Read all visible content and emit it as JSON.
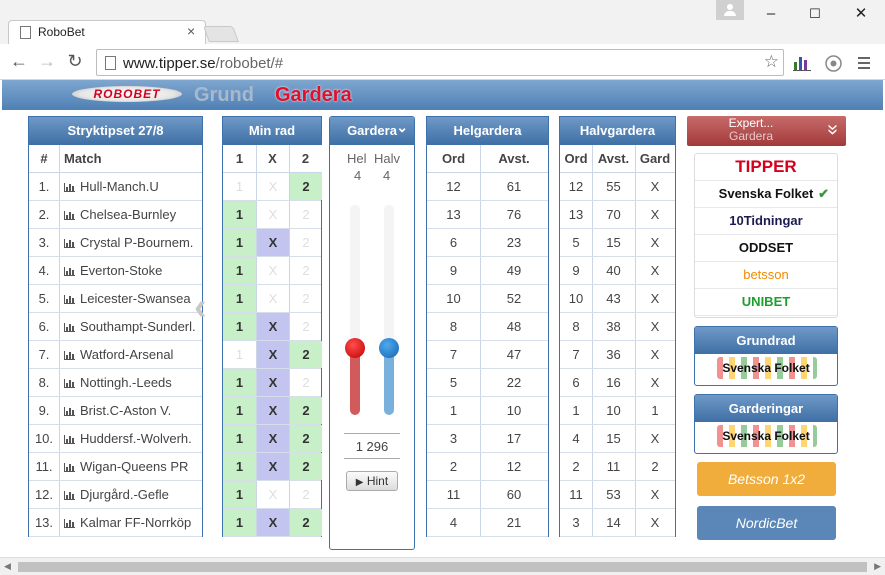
{
  "browser": {
    "tab_title": "RoboBet",
    "tab_close": "×",
    "url_host": "www.tipper.se",
    "url_path": "/robobet/#",
    "win_minimize": "–",
    "win_maximize": "☐",
    "win_close": "✕"
  },
  "app": {
    "logo_text": "ROBOBET",
    "nav_grund": "Grund",
    "nav_gardera": "Gardera"
  },
  "stryktipset": {
    "title": "Stryktipset 27/8",
    "col_num": "#",
    "col_match": "Match",
    "matches": [
      {
        "num": "1.",
        "name": "Hull-Manch.U"
      },
      {
        "num": "2.",
        "name": "Chelsea-Burnley"
      },
      {
        "num": "3.",
        "name": "Crystal P-Bournem."
      },
      {
        "num": "4.",
        "name": "Everton-Stoke"
      },
      {
        "num": "5.",
        "name": "Leicester-Swansea"
      },
      {
        "num": "6.",
        "name": "Southampt-Sunderl."
      },
      {
        "num": "7.",
        "name": "Watford-Arsenal"
      },
      {
        "num": "8.",
        "name": "Nottingh.-Leeds"
      },
      {
        "num": "9.",
        "name": "Brist.C-Aston V."
      },
      {
        "num": "10.",
        "name": "Huddersf.-Wolverh."
      },
      {
        "num": "11.",
        "name": "Wigan-Queens PR"
      },
      {
        "num": "12.",
        "name": "Djurgård.-Gefle"
      },
      {
        "num": "13.",
        "name": "Kalmar FF-Norrköp"
      }
    ]
  },
  "minrad": {
    "title": "Min rad",
    "cols": [
      "1",
      "X",
      "2"
    ],
    "rows": [
      [
        0,
        0,
        1
      ],
      [
        1,
        0,
        0
      ],
      [
        1,
        1,
        0
      ],
      [
        1,
        0,
        0
      ],
      [
        1,
        0,
        0
      ],
      [
        1,
        1,
        0
      ],
      [
        0,
        1,
        1
      ],
      [
        1,
        1,
        0
      ],
      [
        1,
        1,
        1
      ],
      [
        1,
        1,
        1
      ],
      [
        1,
        1,
        1
      ],
      [
        1,
        0,
        0
      ],
      [
        1,
        1,
        1
      ]
    ]
  },
  "gardera": {
    "title": "Gardera",
    "chevron": "⌄",
    "hel_label": "Hel",
    "halv_label": "Halv",
    "hel_value": "4",
    "halv_value": "4",
    "hel_level": 0.32,
    "halv_level": 0.32,
    "count": "1 296",
    "hint_label": "Hint",
    "hint_icon": "▶"
  },
  "helgardera": {
    "title": "Helgardera",
    "col_ord": "Ord",
    "col_avst": "Avst.",
    "rows": [
      [
        "12",
        "61"
      ],
      [
        "13",
        "76"
      ],
      [
        "6",
        "23"
      ],
      [
        "9",
        "49"
      ],
      [
        "10",
        "52"
      ],
      [
        "8",
        "48"
      ],
      [
        "7",
        "47"
      ],
      [
        "5",
        "22"
      ],
      [
        "1",
        "10"
      ],
      [
        "3",
        "17"
      ],
      [
        "2",
        "12"
      ],
      [
        "11",
        "60"
      ],
      [
        "4",
        "21"
      ]
    ]
  },
  "halvgardera": {
    "title": "Halvgardera",
    "col_ord": "Ord",
    "col_avst": "Avst.",
    "col_gard": "Gard",
    "rows": [
      [
        "12",
        "55",
        "X"
      ],
      [
        "13",
        "70",
        "X"
      ],
      [
        "5",
        "15",
        "X"
      ],
      [
        "9",
        "40",
        "X"
      ],
      [
        "10",
        "43",
        "X"
      ],
      [
        "8",
        "38",
        "X"
      ],
      [
        "7",
        "36",
        "X"
      ],
      [
        "6",
        "16",
        "X"
      ],
      [
        "1",
        "10",
        "1"
      ],
      [
        "4",
        "15",
        "X"
      ],
      [
        "2",
        "11",
        "2"
      ],
      [
        "11",
        "53",
        "X"
      ],
      [
        "3",
        "14",
        "X"
      ]
    ]
  },
  "expert": {
    "line1": "Expert...",
    "line2": "Gardera",
    "chevron": "»",
    "check": "✔",
    "brands": [
      {
        "label": "TIPPER",
        "color": "#d4001c"
      },
      {
        "label": "Svenska Folket",
        "color": "#111111"
      },
      {
        "label": "10Tidningar",
        "color": "#1b1b4f"
      },
      {
        "label": "ODDSET",
        "color": "#111111"
      },
      {
        "label": "betsson",
        "color": "#f28b00"
      },
      {
        "label": "UNIBET",
        "color": "#1e9e2e"
      }
    ]
  },
  "grundrad": {
    "title": "Grundrad",
    "logo": "Svenska Folket"
  },
  "garderingar": {
    "title": "Garderingar",
    "logo": "Svenska Folket"
  },
  "betsson_btn": {
    "label": "Betsson 1x2",
    "color": "#f0ad3c"
  },
  "nordicbet_btn": {
    "label": "NordicBet",
    "color": "#5b86b8"
  },
  "side_arrow": "‹"
}
